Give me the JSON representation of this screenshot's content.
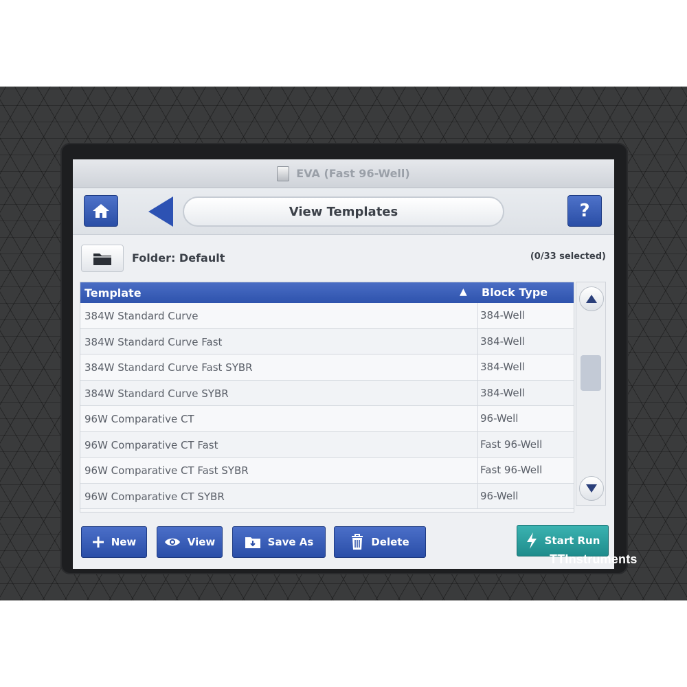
{
  "titlebar": {
    "title": "EVA (Fast 96-Well)"
  },
  "navbar": {
    "page_title": "View Templates",
    "help_label": "?"
  },
  "folder": {
    "label": "Folder:  Default",
    "selected_count": "(0/33 selected)"
  },
  "table": {
    "headers": {
      "template": "Template",
      "block_type": "Block Type",
      "sort_indicator": "▲"
    },
    "rows": [
      {
        "template": "384W Standard Curve",
        "block_type": "384-Well"
      },
      {
        "template": "384W Standard Curve Fast",
        "block_type": "384-Well"
      },
      {
        "template": "384W Standard Curve Fast SYBR",
        "block_type": "384-Well"
      },
      {
        "template": "384W Standard Curve SYBR",
        "block_type": "384-Well"
      },
      {
        "template": "96W Comparative CT",
        "block_type": "96-Well"
      },
      {
        "template": "96W Comparative CT Fast",
        "block_type": "Fast 96-Well"
      },
      {
        "template": "96W Comparative CT Fast SYBR",
        "block_type": "Fast 96-Well"
      },
      {
        "template": "96W Comparative CT SYBR",
        "block_type": "96-Well"
      }
    ]
  },
  "toolbar": {
    "new_label": "New",
    "view_label": "View",
    "save_as_label": "Save As",
    "delete_label": "Delete",
    "start_run_label": "Start Run"
  },
  "watermark": "TTInstruments",
  "colors": {
    "accent_blue": "#2e53ad",
    "start_teal": "#1f8c8c"
  },
  "icons": [
    "home-icon",
    "back-arrow-icon",
    "help-icon",
    "folder-icon",
    "sort-asc-icon",
    "scroll-up-icon",
    "scroll-down-icon",
    "plus-icon",
    "eye-icon",
    "save-as-icon",
    "trash-icon",
    "lightning-icon"
  ]
}
